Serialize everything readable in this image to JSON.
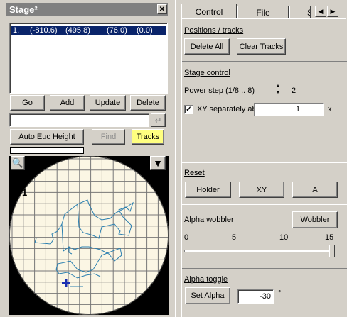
{
  "left_panel": {
    "title": "Stage²",
    "close_icon": "close-icon",
    "positions_list": [
      {
        "index": "1.",
        "x": "(-810.6)",
        "y": "(495.8)",
        "z": "(76.0)",
        "a": "(0.0)"
      }
    ],
    "buttons": {
      "go": "Go",
      "add": "Add",
      "update": "Update",
      "delete": "Delete"
    },
    "name_input_value": "",
    "auto_euc": "Auto Euc Height",
    "find": "Find",
    "tracks": "Tracks",
    "zoom_icon": "zoom-in-icon",
    "dropdown_icon": "triangle-down-icon",
    "map_label": "1"
  },
  "tabs": {
    "items": [
      "Control",
      "File",
      "Se"
    ],
    "active": "Control"
  },
  "right_panel": {
    "positions_tracks": {
      "label": "Positions / tracks",
      "delete_all": "Delete All",
      "clear_tracks": "Clear Tracks"
    },
    "stage_control": {
      "label": "Stage control",
      "power_step_label": "Power step (1/8 .. 8)",
      "power_step_value": "2",
      "xy_separately_label": "XY separately above",
      "xy_separately_checked": true,
      "xy_value": "1",
      "xy_unit": "x"
    },
    "reset": {
      "label": "Reset",
      "holder": "Holder",
      "xy": "XY",
      "a": "A"
    },
    "alpha_wobbler": {
      "label": "Alpha wobbler",
      "wobbler_button": "Wobbler",
      "scale_ticks": [
        "0",
        "5",
        "10",
        "15"
      ],
      "value": 15
    },
    "alpha_toggle": {
      "label": "Alpha toggle",
      "set_alpha": "Set Alpha",
      "value": "-30",
      "unit": "°"
    }
  },
  "colors": {
    "map_background": "#fbf6e4",
    "track": "#2a7fb0",
    "marker": "#1b2fb0",
    "tracks_button": "#ffff80",
    "selection": "#0a246a"
  }
}
